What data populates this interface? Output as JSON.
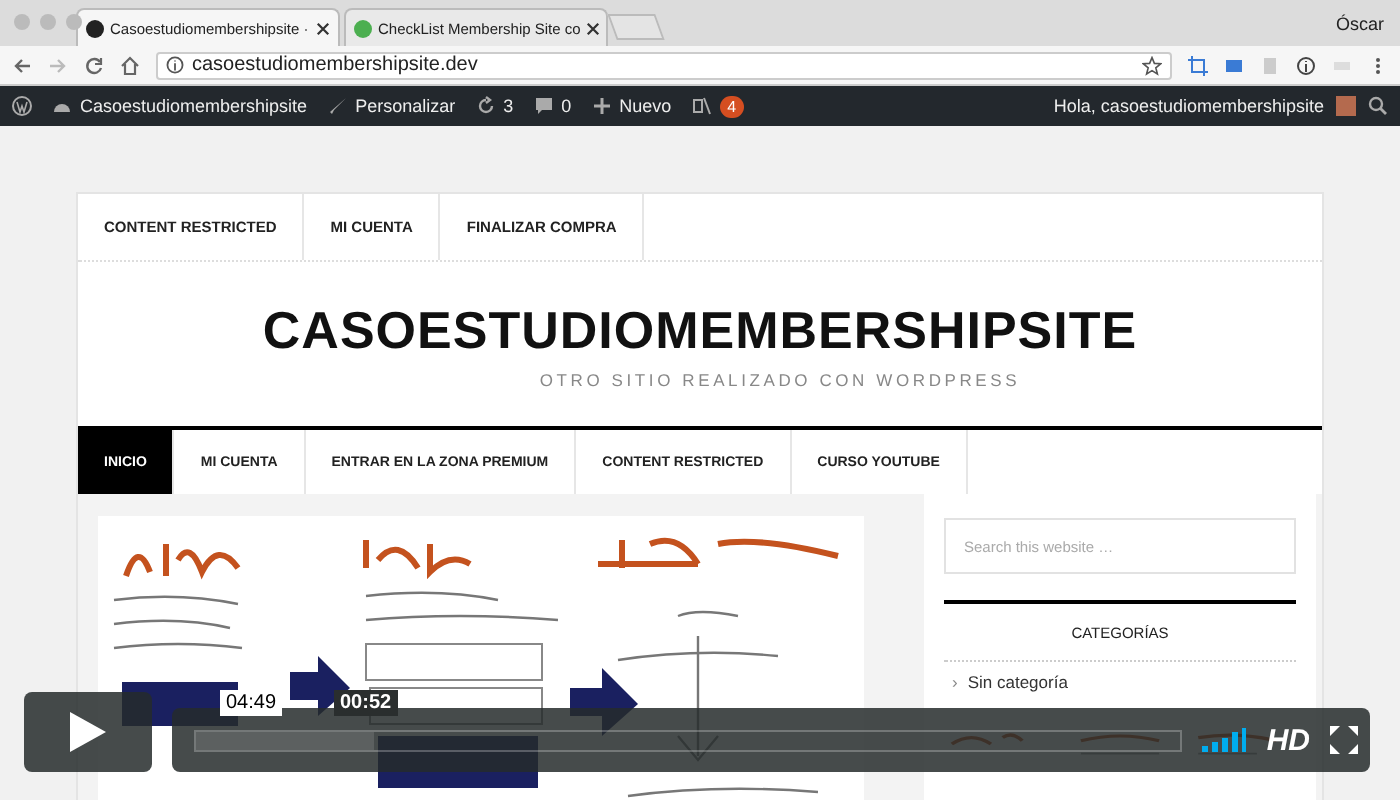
{
  "browser": {
    "tabs": [
      {
        "label": "Casoestudiomembershipsite ·",
        "selected": true
      },
      {
        "label": "CheckList Membership Site co",
        "selected": false
      }
    ],
    "profile": "Óscar",
    "address": "casoestudiomembershipsite.dev"
  },
  "admin_bar": {
    "site": "Casoestudiomembershipsite",
    "customize": "Personalizar",
    "updates": "3",
    "comments": "0",
    "new": "Nuevo",
    "notifications": "4",
    "greeting": "Hola, casoestudiomembershipsite"
  },
  "top_menu": [
    "CONTENT RESTRICTED",
    "MI CUENTA",
    "FINALIZAR COMPRA"
  ],
  "site": {
    "title": "CASOESTUDIOMEMBERSHIPSITE",
    "tagline": "OTRO SITIO REALIZADO CON WORDPRESS"
  },
  "main_menu": [
    {
      "label": "INICIO",
      "selected": true
    },
    {
      "label": "MI CUENTA",
      "selected": false
    },
    {
      "label": "ENTRAR EN LA ZONA PREMIUM",
      "selected": false
    },
    {
      "label": "CONTENT RESTRICTED",
      "selected": false
    },
    {
      "label": "CURSO YOUTUBE",
      "selected": false
    }
  ],
  "sidebar": {
    "search": {
      "placeholder": "Search this website …"
    },
    "categories": {
      "title": "CATEGORÍAS",
      "items": [
        {
          "bullet": "›",
          "label": "Sin categoría"
        }
      ]
    }
  },
  "player": {
    "hover_time": "04:49",
    "current_time": "00:52",
    "quality": "HD",
    "level": 0.18
  }
}
